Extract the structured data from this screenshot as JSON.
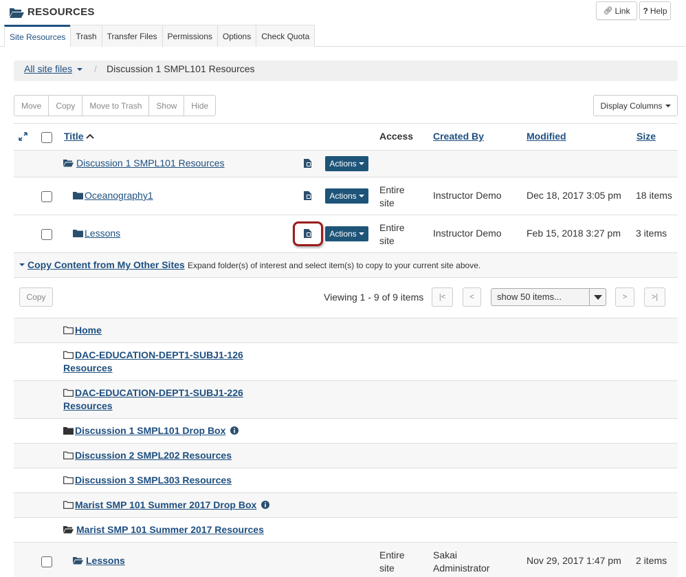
{
  "header": {
    "title": "RESOURCES",
    "link_label": "Link",
    "help_label": "Help"
  },
  "tabs": [
    {
      "label": "Site Resources",
      "active": true
    },
    {
      "label": "Trash"
    },
    {
      "label": "Transfer Files"
    },
    {
      "label": "Permissions"
    },
    {
      "label": "Options"
    },
    {
      "label": "Check Quota"
    }
  ],
  "breadcrumb": {
    "all": "All site files",
    "separator": "/",
    "current": "Discussion 1 SMPL101 Resources"
  },
  "toolbar": {
    "buttons": [
      "Move",
      "Copy",
      "Move to Trash",
      "Show",
      "Hide"
    ],
    "display_columns": "Display Columns"
  },
  "table": {
    "headers": {
      "title": "Title",
      "access": "Access",
      "created_by": "Created By",
      "modified": "Modified",
      "size": "Size"
    },
    "parent": {
      "title": "Discussion 1 SMPL101 Resources",
      "actions": "Actions"
    },
    "rows": [
      {
        "title": "Oceanography1",
        "actions": "Actions",
        "access_1": "Entire",
        "access_2": "site",
        "created_by": "Instructor Demo",
        "modified": "Dec 18, 2017 3:05 pm",
        "size": "18 items"
      },
      {
        "title": "Lessons",
        "actions": "Actions",
        "access_1": "Entire",
        "access_2": "site",
        "created_by": "Instructor Demo",
        "modified": "Feb 15, 2018 3:27 pm",
        "size": "3 items"
      }
    ]
  },
  "copy_section": {
    "toggle": "Copy Content from My Other Sites",
    "note": "Expand folder(s) of interest and select item(s) to copy to your current site above.",
    "copy_button": "Copy",
    "viewing": "Viewing 1 - 9 of 9 items",
    "pager": {
      "first": "|<",
      "prev": "<",
      "next": ">",
      "last": ">|"
    },
    "page_size": "show 50 items...",
    "sites": [
      {
        "line1": "Home",
        "line2": ""
      },
      {
        "line1": "DAC-EDUCATION-DEPT1-SUBJ1-126",
        "line2": "Resources"
      },
      {
        "line1": "DAC-EDUCATION-DEPT1-SUBJ1-226",
        "line2": "Resources"
      },
      {
        "line1": "Discussion 1 SMPL101 Drop Box",
        "line2": ""
      },
      {
        "line1": "Discussion 2 SMPL202 Resources",
        "line2": ""
      },
      {
        "line1": "Discussion 3 SMPL303 Resources",
        "line2": ""
      },
      {
        "line1": "Marist SMP 101 Summer 2017 Drop Box",
        "line2": ""
      },
      {
        "line1": "Marist SMP 101 Summer 2017 Resources",
        "line2": ""
      }
    ],
    "sub_row": {
      "title": "Lessons",
      "access_1": "Entire",
      "access_2": "site",
      "created_by_1": "Sakai",
      "created_by_2": "Administrator",
      "modified": "Nov 29, 2017 1:47 pm",
      "size": "2 items"
    }
  },
  "colors": {
    "accent": "#1e4f80",
    "actions_button": "#1e5478",
    "highlight": "#9b1c1c"
  }
}
